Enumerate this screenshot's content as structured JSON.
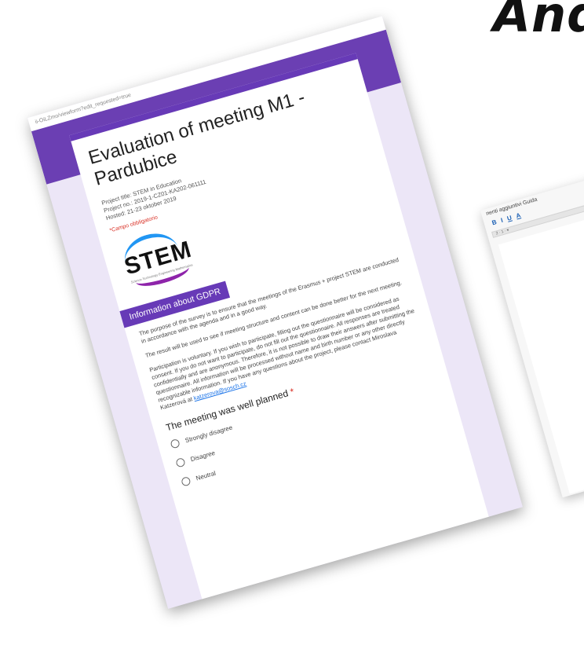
{
  "headline": "And",
  "browser": {
    "url": "ii-OiLZmo/viewform?edit_requested=true"
  },
  "form": {
    "title": "Evaluation of meeting M1 - Pardubice",
    "meta": [
      "Project title: STEM in Education",
      "Project no.: 2019-1-CZ01-KA202-061111",
      "Hosted: 21-23 oktober 2019"
    ],
    "required_note": "*Campo obbligatorio",
    "logo": {
      "word": "STEM",
      "subtitle": "Science Technology Engineering Mathematics"
    },
    "section_title": "Information about GDPR",
    "paragraphs": {
      "p1": "The purpose of the survey is to ensure that the meetings of the Erasmus + project STEM are conducted in accordance with the agenda and in a good way.",
      "p2": "The result will be used to see if meeting structure and content can be done better for the next meeting.",
      "p3": "Participation is voluntary. If you wish to participate, filling out the questionnaire will be considered as consent. If you do not want to participate, do not fill out the questionnaire. All responses are treated confidentially and are anonymous. Therefore, it is not possible to draw their answers after submitting the questionnaire. All information will be processed without name and birth number or any other directly recognizable information. If you have any questions about the project, please contact Miroslava Katzerová at",
      "email": "katzerova@sosch.cz"
    },
    "question": {
      "label": "The meeting was well planned",
      "required_marker": "*"
    },
    "options": [
      "Strongly disagree",
      "Disagree",
      "Neutral"
    ]
  },
  "editor": {
    "menu": "nenti aggiuntivi  Guida",
    "tools": [
      "B",
      "I",
      "U",
      "A"
    ],
    "ruler": "2 · 1 · ▾"
  }
}
